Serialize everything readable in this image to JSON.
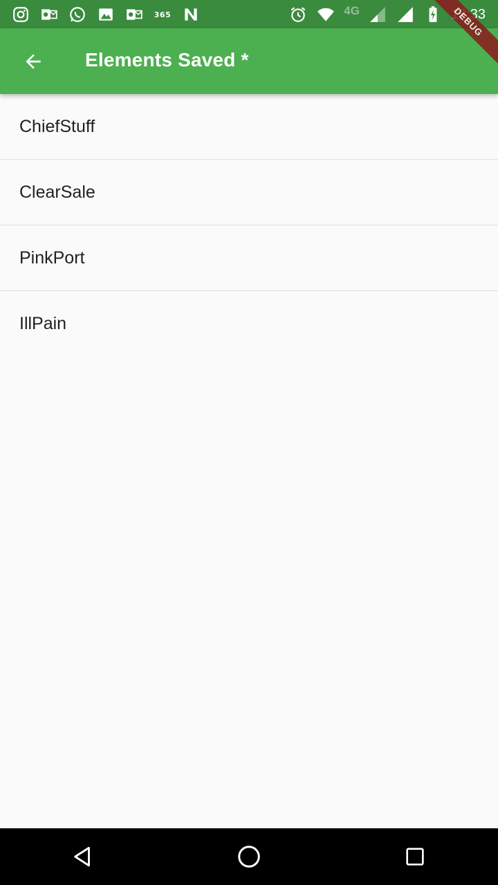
{
  "status_bar": {
    "left_icons": [
      "instagram-icon",
      "outlook-icon",
      "whatsapp-icon",
      "gallery-icon",
      "outlook-icon",
      "office365-icon",
      "n-app-icon"
    ],
    "office365_label": "365",
    "network_label": "4G",
    "time": "13:33"
  },
  "app_bar": {
    "title": "Elements Saved *",
    "back_icon": "arrow-back-icon",
    "background_color": "#4caf50"
  },
  "debug_banner": "DEBUG",
  "items": [
    {
      "label": "ChiefStuff"
    },
    {
      "label": "ClearSale"
    },
    {
      "label": "PinkPort"
    },
    {
      "label": "IllPain"
    }
  ],
  "nav_bar": {
    "buttons": [
      "back-triangle-icon",
      "home-circle-icon",
      "recents-square-icon"
    ]
  }
}
